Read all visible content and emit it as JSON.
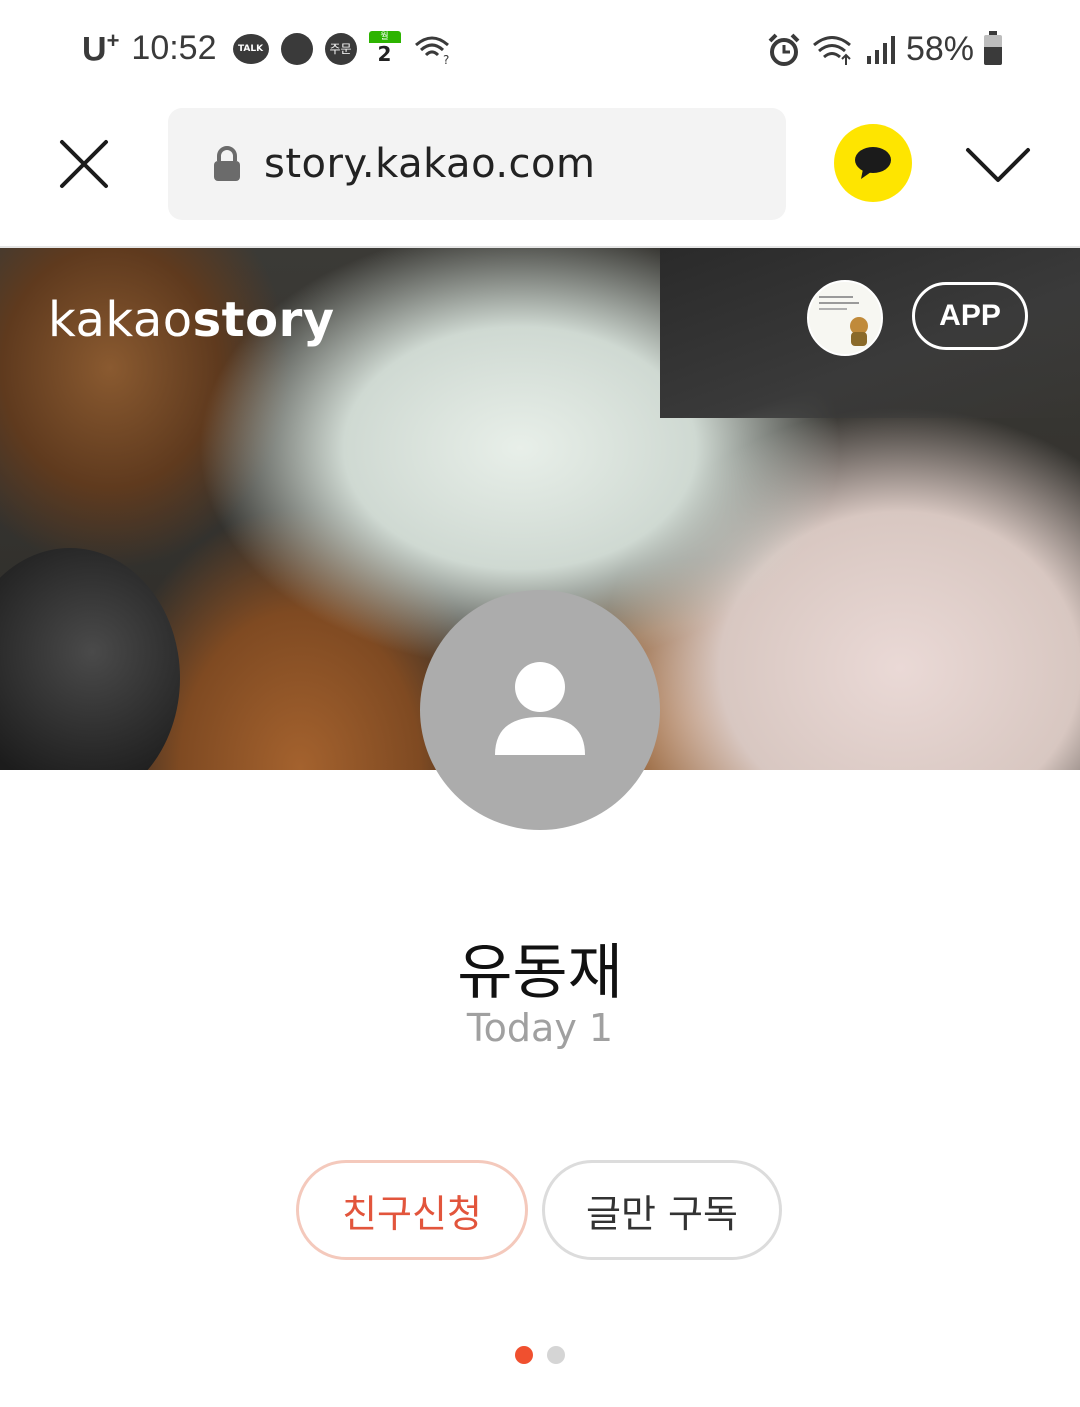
{
  "status_bar": {
    "carrier": "U",
    "carrier_sup": "+",
    "time": "10:52",
    "talk_badge": "TALK",
    "order_badge": "주문",
    "calendar_weekday": "월",
    "calendar_day": "2",
    "battery": "58%",
    "battery_level": 0.58
  },
  "browser": {
    "url": "story.kakao.com"
  },
  "cover": {
    "brand_light": "kakao",
    "brand_bold": "story",
    "app_button": "APP"
  },
  "profile": {
    "name": "유동재",
    "today_label": "Today 1"
  },
  "actions": {
    "friend_request": "친구신청",
    "subscribe_posts": "글만 구독"
  },
  "pagination": {
    "active_index": 0,
    "count": 2,
    "active_color": "#f0502f",
    "inactive_color": "#d5d5d5"
  },
  "colors": {
    "kakao_yellow": "#fee500",
    "friend_accent": "#e2553c"
  }
}
